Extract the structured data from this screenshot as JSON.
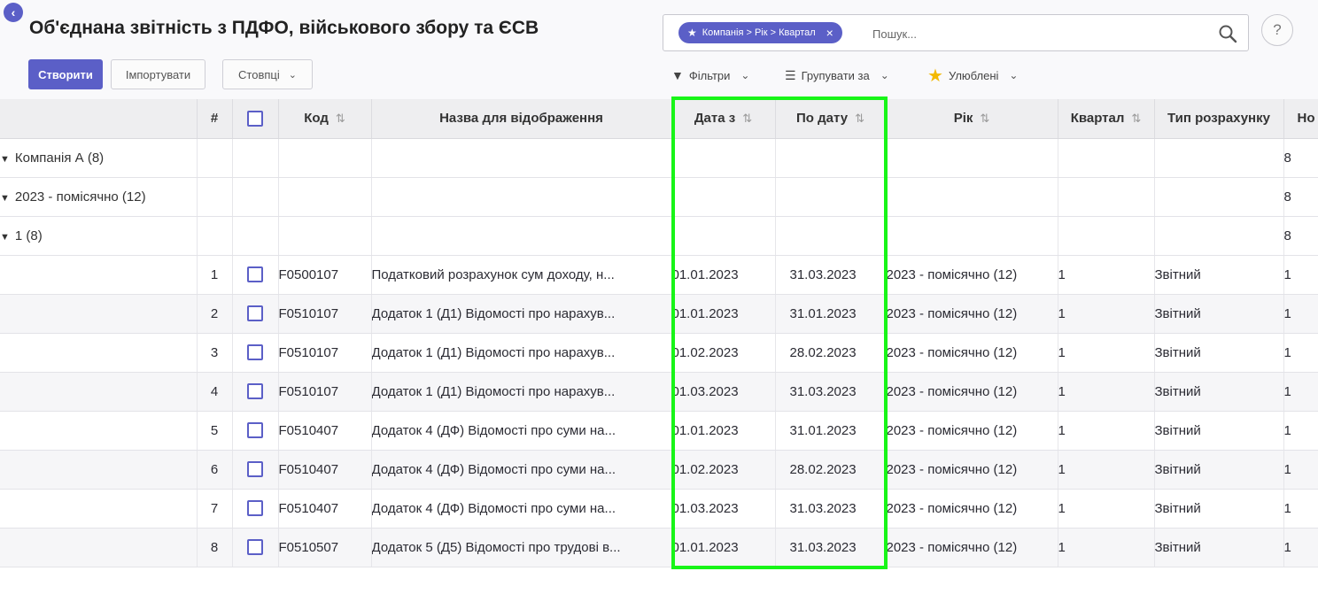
{
  "header": {
    "title": "Об'єднана звітність з ПДФО, військового збору та ЄСВ",
    "back_icon": "chevron-left-icon",
    "create_label": "Створити",
    "import_label": "Імпортувати",
    "columns_label": "Стовпці"
  },
  "search": {
    "facet_label": "Компанія > Рік > Квартал",
    "placeholder": "Пошук...",
    "accent": "#5b5fc7"
  },
  "controls": {
    "filters_label": "Фільтри",
    "group_label": "Групувати за",
    "favorites_label": "Улюблені",
    "help_label": "?"
  },
  "table": {
    "columns": {
      "num": "#",
      "code": "Код",
      "name": "Назва для відображення",
      "date_from": "Дата з",
      "date_to": "По дату",
      "year": "Рік",
      "quarter": "Квартал",
      "calc_type": "Тип розрахунку",
      "no": "Но"
    },
    "groups": [
      {
        "label": "Компанія А (8)",
        "count": "8"
      },
      {
        "label": "2023 - помісячно (12)",
        "count": "8"
      },
      {
        "label": "1 (8)",
        "count": "8"
      }
    ],
    "rows": [
      {
        "num": "1",
        "code": "F0500107",
        "name": "Податковий розрахунок сум доходу, н...",
        "date_from": "01.01.2023",
        "date_to": "31.03.2023",
        "year": "2023 - помісячно (12)",
        "quarter": "1",
        "calc_type": "Звітний",
        "no": "1"
      },
      {
        "num": "2",
        "code": "F0510107",
        "name": "Додаток 1 (Д1) Відомості про нарахув...",
        "date_from": "01.01.2023",
        "date_to": "31.01.2023",
        "year": "2023 - помісячно (12)",
        "quarter": "1",
        "calc_type": "Звітний",
        "no": "1"
      },
      {
        "num": "3",
        "code": "F0510107",
        "name": "Додаток 1 (Д1) Відомості про нарахув...",
        "date_from": "01.02.2023",
        "date_to": "28.02.2023",
        "year": "2023 - помісячно (12)",
        "quarter": "1",
        "calc_type": "Звітний",
        "no": "1"
      },
      {
        "num": "4",
        "code": "F0510107",
        "name": "Додаток 1 (Д1) Відомості про нарахув...",
        "date_from": "01.03.2023",
        "date_to": "31.03.2023",
        "year": "2023 - помісячно (12)",
        "quarter": "1",
        "calc_type": "Звітний",
        "no": "1"
      },
      {
        "num": "5",
        "code": "F0510407",
        "name": "Додаток 4 (ДФ) Відомості про суми на...",
        "date_from": "01.01.2023",
        "date_to": "31.01.2023",
        "year": "2023 - помісячно (12)",
        "quarter": "1",
        "calc_type": "Звітний",
        "no": "1"
      },
      {
        "num": "6",
        "code": "F0510407",
        "name": "Додаток 4 (ДФ) Відомості про суми на...",
        "date_from": "01.02.2023",
        "date_to": "28.02.2023",
        "year": "2023 - помісячно (12)",
        "quarter": "1",
        "calc_type": "Звітний",
        "no": "1"
      },
      {
        "num": "7",
        "code": "F0510407",
        "name": "Додаток 4 (ДФ) Відомості про суми на...",
        "date_from": "01.03.2023",
        "date_to": "31.03.2023",
        "year": "2023 - помісячно (12)",
        "quarter": "1",
        "calc_type": "Звітний",
        "no": "1"
      },
      {
        "num": "8",
        "code": "F0510507",
        "name": "Додаток 5 (Д5) Відомості про трудові в...",
        "date_from": "01.01.2023",
        "date_to": "31.03.2023",
        "year": "2023 - помісячно (12)",
        "quarter": "1",
        "calc_type": "Звітний",
        "no": "1"
      }
    ]
  },
  "highlight_color": "#18f518"
}
